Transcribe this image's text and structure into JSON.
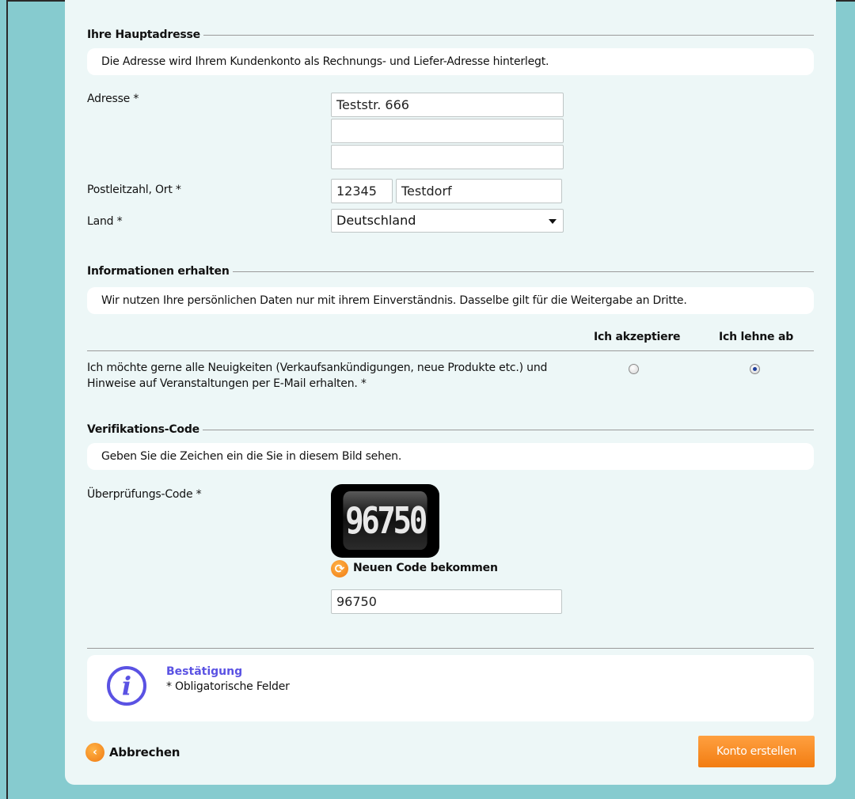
{
  "address_section": {
    "title": "Ihre Hauptadresse",
    "note": "Die Adresse wird Ihrem Kundenkonto als Rechnungs- und Liefer-Adresse hinterlegt.",
    "address_label": "Adresse *",
    "address_line1": "Teststr. 666",
    "address_line2": "",
    "address_line3": "",
    "zip_city_label": "Postleitzahl, Ort *",
    "zip": "12345",
    "city": "Testdorf",
    "country_label": "Land *",
    "country": "Deutschland"
  },
  "info_section": {
    "title": "Informationen erhalten",
    "note": "Wir nutzen Ihre persönlichen Daten nur mit ihrem Einverständnis. Dasselbe gilt für die Weitergabe an Dritte.",
    "accept_col": "Ich akzeptiere",
    "decline_col": "Ich lehne ab",
    "newsletter_text_line1": "Ich möchte gerne alle Neuigkeiten (Verkaufsankündigungen, neue Produkte etc.) und",
    "newsletter_text_line2": "Hinweise auf Veranstaltungen per E-Mail erhalten. *",
    "selected": "decline"
  },
  "verification_section": {
    "title": "Verifikations-Code",
    "note": "Geben Sie die Zeichen ein die Sie in diesem Bild sehen.",
    "code_label": "Überprüfungs-Code *",
    "captcha_text": "96750",
    "refresh_label": "Neuen Code bekommen",
    "code_value": "96750"
  },
  "confirmation": {
    "title": "Bestätigung",
    "text": "* Obligatorische Felder"
  },
  "actions": {
    "cancel_label": "Abbrechen",
    "submit_label": "Konto erstellen"
  },
  "colors": {
    "background": "#86cbcf",
    "panel": "#edf7f7",
    "accent_orange": "#f27d12",
    "info_blue": "#5a52e3"
  }
}
